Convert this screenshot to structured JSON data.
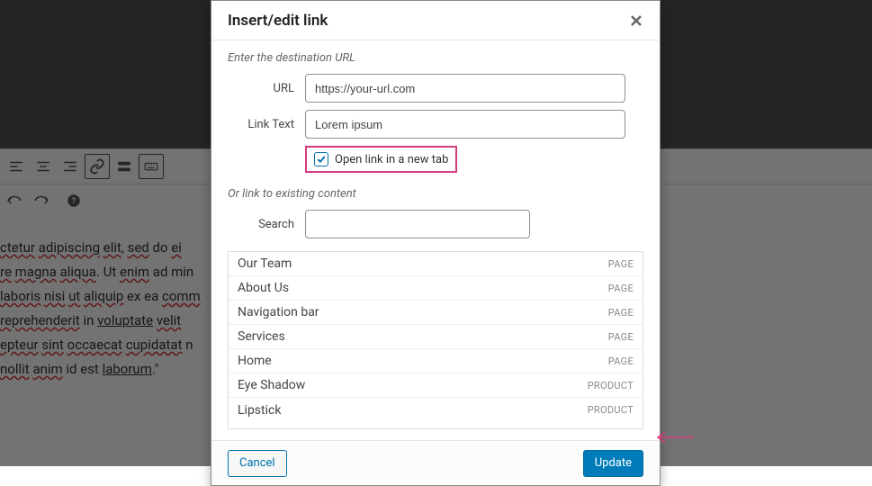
{
  "dialog": {
    "title": "Insert/edit link",
    "hint1": "Enter the destination URL",
    "url_label": "URL",
    "url_value": "https://your-url.com",
    "linktext_label": "Link Text",
    "linktext_value": "Lorem ipsum",
    "newtab_label": "Open link in a new tab",
    "hint2": "Or link to existing content",
    "search_label": "Search",
    "results": [
      {
        "name": "Our Team",
        "type": "PAGE"
      },
      {
        "name": "About Us",
        "type": "PAGE"
      },
      {
        "name": "Navigation bar",
        "type": "PAGE"
      },
      {
        "name": "Services",
        "type": "PAGE"
      },
      {
        "name": "Home",
        "type": "PAGE"
      },
      {
        "name": "Eye Shadow",
        "type": "PRODUCT"
      },
      {
        "name": "Lipstick",
        "type": "PRODUCT"
      }
    ],
    "cancel": "Cancel",
    "update": "Update"
  },
  "editor_text": {
    "l1a": "ctetur",
    "l1b": "adipiscing",
    "l1c": "elit",
    "l1d": ",",
    "l1e": "sed",
    "l1f": " do ",
    "l1g": "ei",
    "l2a": "re",
    "l2b": "magna",
    "l2c": "aliqua",
    "l2d": ". Ut ",
    "l2e": "enim",
    "l2f": " ad min",
    "l3a": "laboris",
    "l3b": "nisi",
    "l3c": "ut",
    "l3d": "aliquip",
    "l3e": " ex ea ",
    "l3f": "comm",
    "l4a": "reprehenderit",
    "l4b": " in ",
    "l4c": "voluptate",
    "l4d": "velit",
    "l5a": "epteur",
    "l5b": "sint",
    "l5c": "occaecat",
    "l5d": "cupidatat",
    "l5e": " n",
    "l6a": "nollit",
    "l6b": "anim",
    "l6c": " id est ",
    "l6d": "laborum",
    "l6e": ".\""
  }
}
